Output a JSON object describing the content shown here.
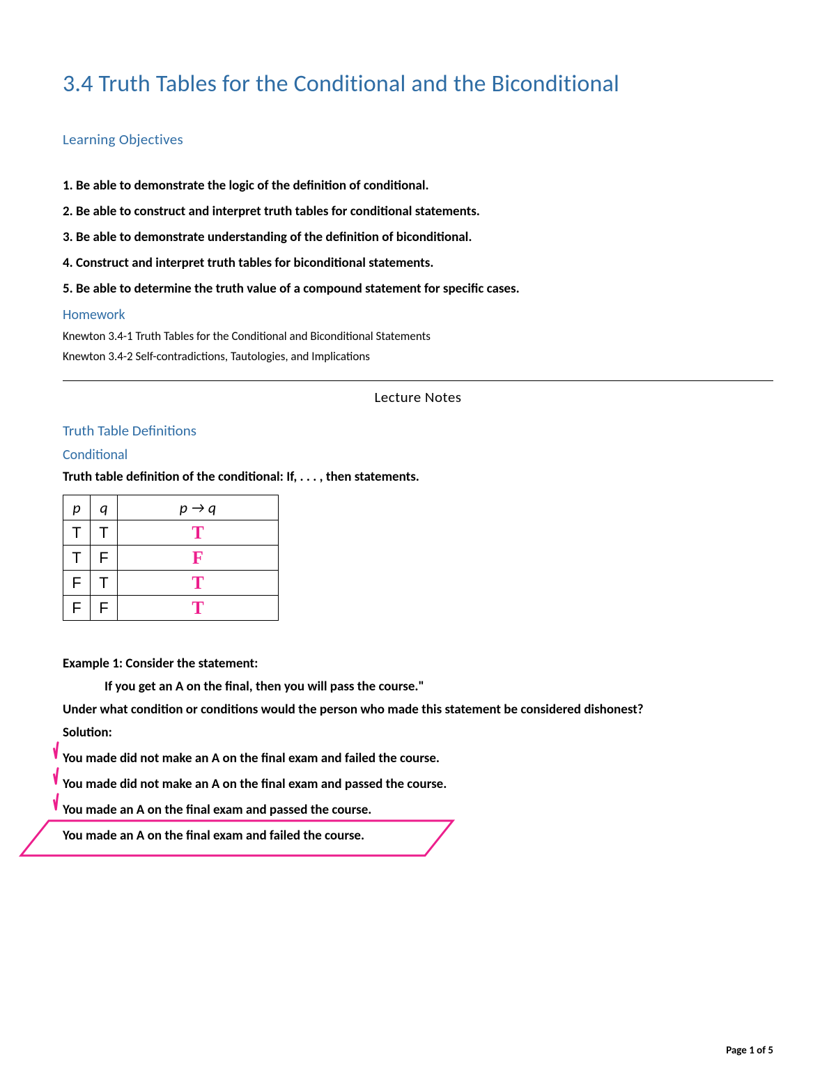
{
  "title": "3.4 Truth Tables for the Conditional and the Biconditional",
  "sections": {
    "learning_objectives_heading": "Learning Objectives",
    "objectives": [
      "1. Be able to demonstrate the logic of the definition of conditional.",
      "2. Be able to construct and interpret truth tables for conditional statements.",
      "3. Be able to demonstrate understanding of the definition of biconditional.",
      "4. Construct and interpret truth tables for biconditional statements.",
      "5. Be able to determine the truth value of a compound statement for specific cases."
    ],
    "homework_heading": "Homework",
    "homework_items": [
      "Knewton 3.4-1 Truth Tables for the Conditional and Biconditional Statements",
      "Knewton 3.4-2 Self-contradictions, Tautologies, and Implications"
    ],
    "lecture_notes_heading": "Lecture Notes",
    "defs_heading": "Truth Table Definitions",
    "conditional_heading": "Conditional",
    "conditional_def": "Truth table definition of the conditional: If, . . . , then statements."
  },
  "truth_table": {
    "headers": {
      "p": "p",
      "q": "q",
      "result": "p  →  q"
    },
    "rows": [
      {
        "p": "T",
        "q": "T",
        "hand": "T"
      },
      {
        "p": "T",
        "q": "F",
        "hand": "F"
      },
      {
        "p": "F",
        "q": "T",
        "hand": "T"
      },
      {
        "p": "F",
        "q": "F",
        "hand": "T"
      }
    ]
  },
  "example": {
    "label": "Example 1:",
    "intro": " Consider the statement:",
    "statement": "If you get an A on the final, then you will pass the course.\"",
    "question": "Under what condition or conditions would the person who made this statement be considered dishonest?",
    "solution_label": "Solution:",
    "options": [
      "You made did not make an A on the final exam and failed the course.",
      "You made did not make an A on the final exam and passed the course.",
      "You made an A on the final exam and passed the course."
    ],
    "boxed": "You made an A on the final exam and failed the course."
  },
  "footer": "Page 1 of 5",
  "colors": {
    "heading_blue": "#2e6ca4",
    "annotation_pink": "#ec1e8c"
  }
}
